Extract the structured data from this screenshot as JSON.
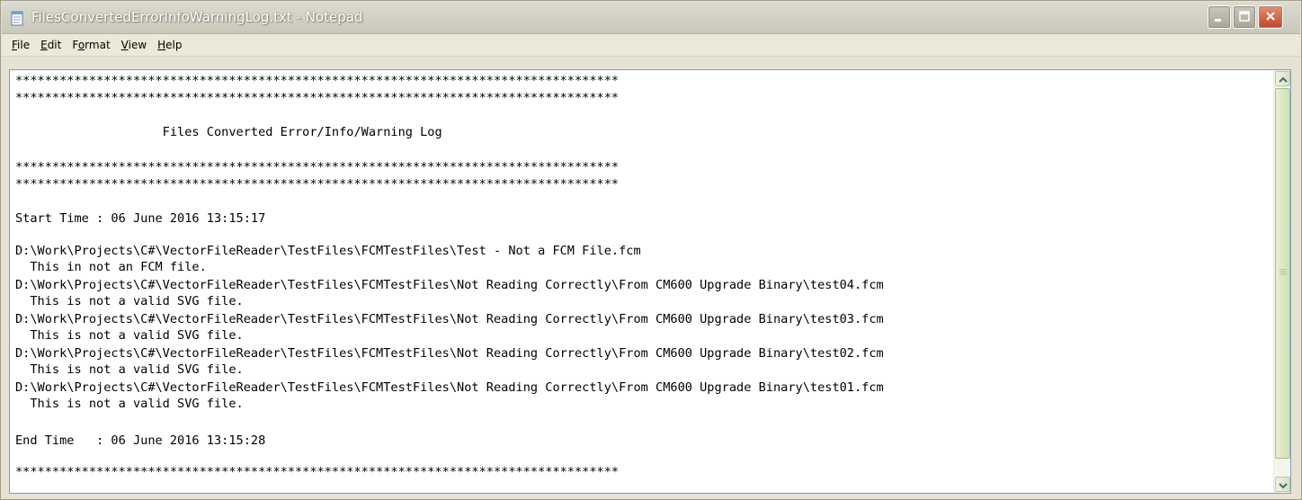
{
  "window": {
    "title": "FilesConvertedErrorInfoWarningLog.txt - Notepad",
    "icon": "notepad-icon"
  },
  "controls": {
    "minimize_icon": "minimize-icon",
    "maximize_icon": "maximize-icon",
    "close_icon": "close-icon"
  },
  "menu": {
    "items": [
      {
        "label": "File",
        "accel": "F",
        "rest": "ile"
      },
      {
        "label": "Edit",
        "accel": "E",
        "rest": "dit"
      },
      {
        "label": "Format",
        "pre": "F",
        "accel": "o",
        "rest": "rmat"
      },
      {
        "label": "View",
        "accel": "V",
        "rest": "iew"
      },
      {
        "label": "Help",
        "accel": "H",
        "rest": "elp"
      }
    ]
  },
  "document": {
    "lines": [
      "**********************************************************************************",
      "**********************************************************************************",
      "",
      "                    Files Converted Error/Info/Warning Log",
      "",
      "**********************************************************************************",
      "**********************************************************************************",
      "",
      "Start Time : 06 June 2016 13:15:17",
      "",
      "D:\\Work\\Projects\\C#\\VectorFileReader\\TestFiles\\FCMTestFiles\\Test - Not a FCM File.fcm",
      "  This in not an FCM file.",
      "D:\\Work\\Projects\\C#\\VectorFileReader\\TestFiles\\FCMTestFiles\\Not Reading Correctly\\From CM600 Upgrade Binary\\test04.fcm",
      "  This is not a valid SVG file.",
      "D:\\Work\\Projects\\C#\\VectorFileReader\\TestFiles\\FCMTestFiles\\Not Reading Correctly\\From CM600 Upgrade Binary\\test03.fcm",
      "  This is not a valid SVG file.",
      "D:\\Work\\Projects\\C#\\VectorFileReader\\TestFiles\\FCMTestFiles\\Not Reading Correctly\\From CM600 Upgrade Binary\\test02.fcm",
      "  This is not a valid SVG file.",
      "D:\\Work\\Projects\\C#\\VectorFileReader\\TestFiles\\FCMTestFiles\\Not Reading Correctly\\From CM600 Upgrade Binary\\test01.fcm",
      "  This is not a valid SVG file.",
      "",
      "End Time   : 06 June 2016 13:15:28",
      "",
      "**********************************************************************************"
    ]
  },
  "scrollbar": {
    "up_icon": "scroll-up-arrow-icon",
    "down_icon": "scroll-down-arrow-icon"
  }
}
